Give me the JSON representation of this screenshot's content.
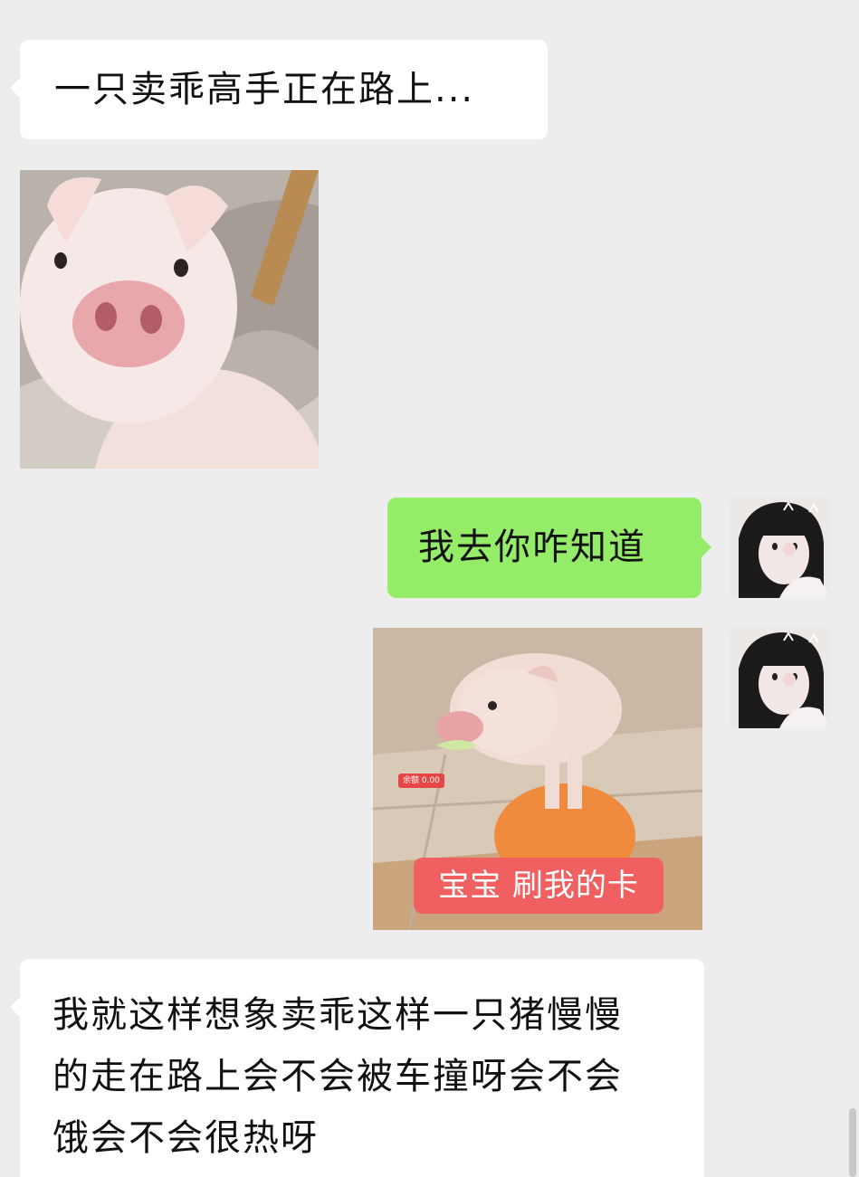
{
  "chat": {
    "messages": [
      {
        "side": "left",
        "type": "text",
        "text": "一只卖乖高手正在路上..."
      },
      {
        "side": "left",
        "type": "image",
        "icon": "piglet-photo"
      },
      {
        "side": "right",
        "type": "text",
        "text": "我去你咋知道"
      },
      {
        "side": "right",
        "type": "image",
        "icon": "piglet-on-ball-meme",
        "badge": "余额 0.00",
        "caption": "宝宝 刷我的卡"
      },
      {
        "side": "left",
        "type": "text",
        "lines": [
          "我就这样想象卖乖这样一只猪慢慢",
          "的走在路上会不会被车撞呀会不会",
          "饿会不会很热呀"
        ]
      }
    ]
  },
  "colors": {
    "background": "#ededed",
    "incoming_bubble": "#ffffff",
    "outgoing_bubble": "#95ec69",
    "caption_red": "#f06060"
  }
}
